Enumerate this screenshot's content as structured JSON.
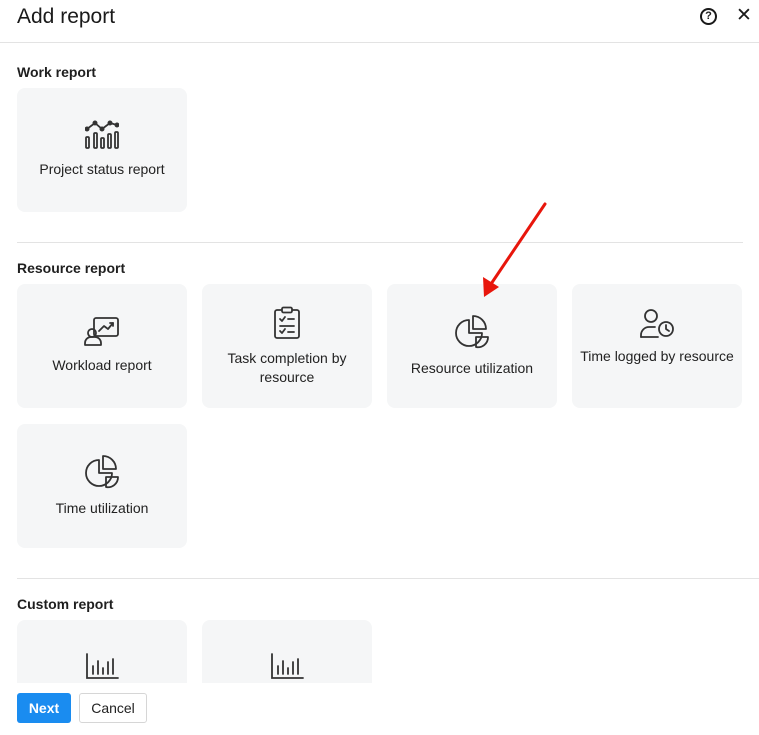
{
  "dialog": {
    "title": "Add report",
    "help_glyph": "?",
    "close_glyph": "✕"
  },
  "sections": {
    "work": {
      "title": "Work report",
      "cards": [
        {
          "label": "Project status report",
          "icon": "line-bar-chart-icon"
        }
      ]
    },
    "resource": {
      "title": "Resource report",
      "cards": [
        {
          "label": "Workload report",
          "icon": "presenter-chart-icon"
        },
        {
          "label": "Task completion by resource",
          "icon": "clipboard-checklist-icon"
        },
        {
          "label": "Resource utilization",
          "icon": "pie-chart-icon"
        },
        {
          "label": "Time logged by resource",
          "icon": "user-clock-icon"
        },
        {
          "label": "Time utilization",
          "icon": "pie-chart-icon"
        }
      ]
    },
    "custom": {
      "title": "Custom report",
      "cards": [
        {
          "label": "",
          "icon": "bar-chart-icon"
        },
        {
          "label": "",
          "icon": "bar-chart-icon"
        }
      ]
    }
  },
  "footer": {
    "next_label": "Next",
    "cancel_label": "Cancel"
  },
  "colors": {
    "accent": "#1a8cf0",
    "card_bg": "#f5f6f7",
    "annotation_arrow": "#e8160c"
  }
}
